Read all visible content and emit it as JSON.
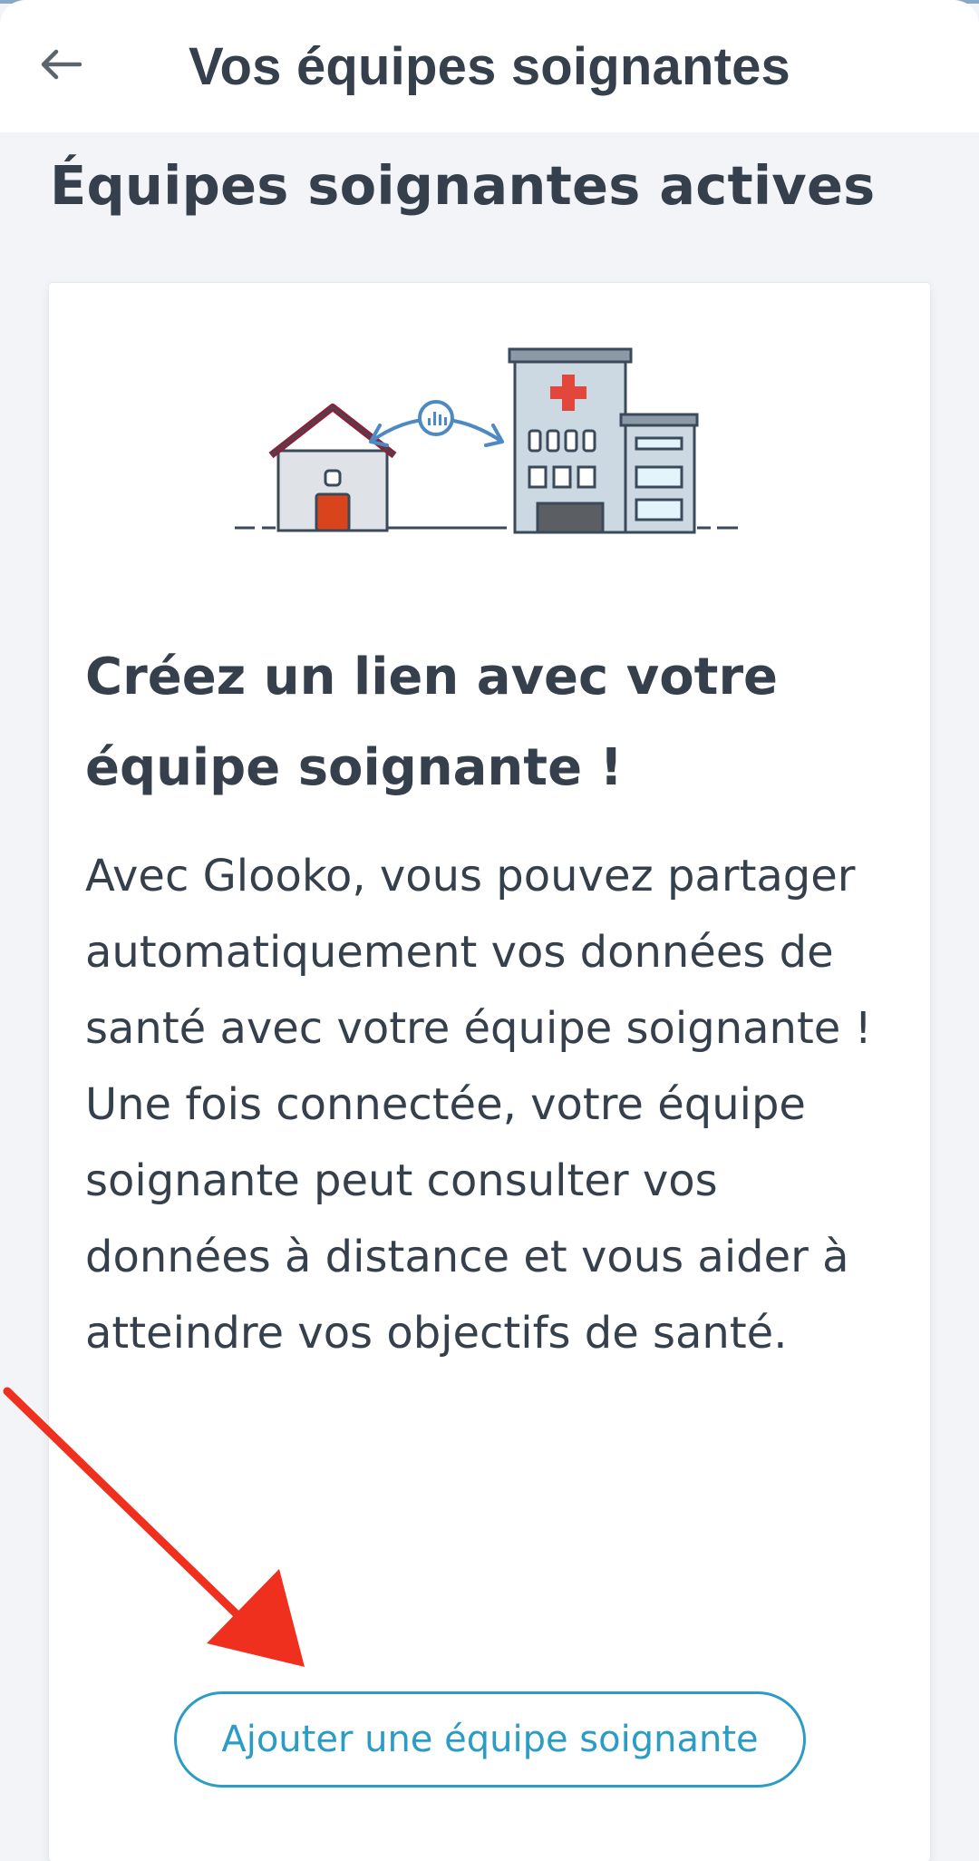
{
  "header": {
    "title": "Vos équipes soignantes",
    "back_icon": "arrow-left-icon"
  },
  "section": {
    "title": "Équipes soignantes actives"
  },
  "card": {
    "illustration_icon": "home-hospital-connection-illustration",
    "heading": "Créez un lien avec votre équipe soignante !",
    "body": "Avec Glooko, vous pouvez partager automatiquement vos données de santé avec votre équipe soignante ! Une fois connectée, votre équipe soignante peut consulter vos données à distance et vous aider à atteindre vos objectifs de santé.",
    "button_label": "Ajouter une équipe soignante"
  },
  "colors": {
    "accent": "#2b9cc6",
    "text": "#35404c",
    "background": "#f3f4f8",
    "annotation_arrow": "#f0301e"
  }
}
